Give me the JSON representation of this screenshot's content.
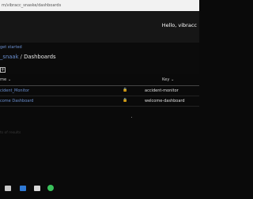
{
  "browser": {
    "url": "m/vibracc_snaske/dashboards"
  },
  "header": {
    "greeting": "Hello, vibracc"
  },
  "banner": {
    "get_started": "get started"
  },
  "breadcrumb": {
    "parent": "_snaak",
    "separator": " / ",
    "current": "Dashboards"
  },
  "toolbar": {
    "add_symbol": "+"
  },
  "table": {
    "columns": {
      "name": "me ⌄",
      "key": "Key ⌄"
    },
    "rows": [
      {
        "name": "cident_Monitor",
        "key": "accident-monitor"
      },
      {
        "name": "come Dashboard",
        "key": "welcome-dashboard"
      }
    ]
  },
  "footer": {
    "faded_text": "ts of results"
  },
  "taskbar": {
    "icons": [
      "file-explorer-icon",
      "mail-icon",
      "chat-icon",
      "whatsapp-icon"
    ]
  }
}
